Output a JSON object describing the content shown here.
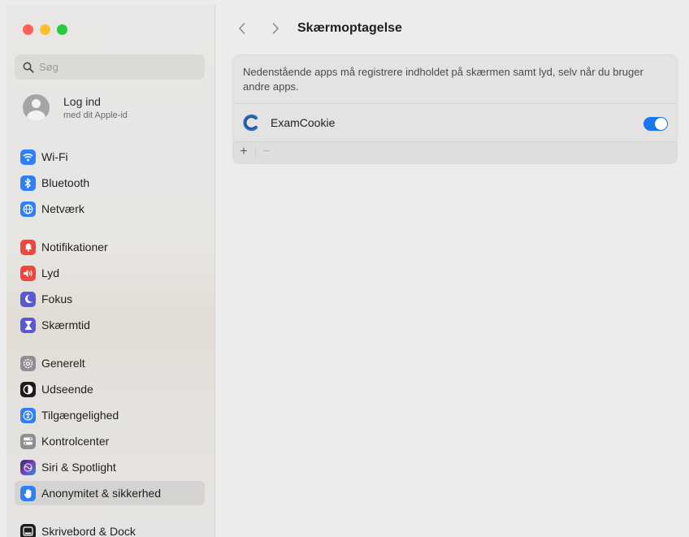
{
  "sidebar": {
    "search_placeholder": "Søg",
    "account": {
      "title": "Log ind",
      "subtitle": "med dit Apple-id"
    },
    "items": [
      {
        "label": "Wi-Fi",
        "icon": "wifi-icon",
        "color": "#2f7ff7"
      },
      {
        "label": "Bluetooth",
        "icon": "bluetooth-icon",
        "color": "#2f7ff7"
      },
      {
        "label": "Netværk",
        "icon": "globe-icon",
        "color": "#2f7ff7"
      },
      {
        "label": "Notifikationer",
        "icon": "bell-icon",
        "color": "#f2453d"
      },
      {
        "label": "Lyd",
        "icon": "speaker-icon",
        "color": "#f2453d"
      },
      {
        "label": "Fokus",
        "icon": "moon-icon",
        "color": "#5b58d6"
      },
      {
        "label": "Skærmtid",
        "icon": "hourglass-icon",
        "color": "#5b58d6"
      },
      {
        "label": "Generelt",
        "icon": "gear-icon",
        "color": "#8e8e93"
      },
      {
        "label": "Udseende",
        "icon": "appearance-icon",
        "color": "#1c1c1e"
      },
      {
        "label": "Tilgængelighed",
        "icon": "accessibility-icon",
        "color": "#2f7ff7"
      },
      {
        "label": "Kontrolcenter",
        "icon": "control-center-icon",
        "color": "#8e8e93"
      },
      {
        "label": "Siri & Spotlight",
        "icon": "siri-icon",
        "color": "#3a3a8c"
      },
      {
        "label": "Anonymitet & sikkerhed",
        "icon": "hand-icon",
        "color": "#2f7ff7",
        "selected": true
      },
      {
        "label": "Skrivebord & Dock",
        "icon": "dock-icon",
        "color": "#1c1c1e"
      }
    ]
  },
  "main": {
    "title": "Skærmoptagelse",
    "description": "Nedenstående apps må registrere indholdet på skærmen samt lyd, selv når du bruger andre apps.",
    "apps": [
      {
        "name": "ExamCookie",
        "enabled": true,
        "icon": "examcookie-icon"
      }
    ],
    "footer": {
      "add_label": "+",
      "remove_label": "−"
    }
  },
  "colors": {
    "accent": "#1876f2",
    "selected_row": "#d5d3d1"
  }
}
